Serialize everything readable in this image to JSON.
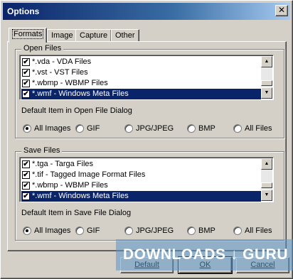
{
  "window": {
    "title": "Options",
    "close_glyph": "✕"
  },
  "tabs": [
    {
      "label": "Formats",
      "active": true
    },
    {
      "label": "Image",
      "active": false
    },
    {
      "label": "Capture",
      "active": false
    },
    {
      "label": "Other",
      "active": false
    }
  ],
  "open_files": {
    "group_label": "Open Files",
    "items": [
      {
        "label": "*.vda - VDA Files",
        "checked": true,
        "selected": false
      },
      {
        "label": "*.vst - VST Files",
        "checked": true,
        "selected": false
      },
      {
        "label": "*.wbmp - WBMP Files",
        "checked": true,
        "selected": false
      },
      {
        "label": "*.wmf - Windows Meta Files",
        "checked": true,
        "selected": true
      }
    ],
    "default_label": "Default Item in Open File Dialog",
    "radios": [
      {
        "label": "All Images",
        "selected": true
      },
      {
        "label": "GIF",
        "selected": false
      },
      {
        "label": "JPG/JPEG",
        "selected": false
      },
      {
        "label": "BMP",
        "selected": false
      },
      {
        "label": "All Files",
        "selected": false
      }
    ]
  },
  "save_files": {
    "group_label": "Save Files",
    "items": [
      {
        "label": "*.tga - Targa Files",
        "checked": true,
        "selected": false
      },
      {
        "label": "*.tif - Tagged Image Format Files",
        "checked": true,
        "selected": false
      },
      {
        "label": "*.wbmp - WBMP Files",
        "checked": true,
        "selected": false
      },
      {
        "label": "*.wmf - Windows Meta Files",
        "checked": true,
        "selected": true
      }
    ],
    "default_label": "Default Item in Save File Dialog",
    "radios": [
      {
        "label": "All Images",
        "selected": true
      },
      {
        "label": "GIF",
        "selected": false
      },
      {
        "label": "JPG/JPEG",
        "selected": false
      },
      {
        "label": "BMP",
        "selected": false
      },
      {
        "label": "All Files",
        "selected": false
      }
    ]
  },
  "buttons": {
    "default": "Default",
    "ok": "OK",
    "cancel": "Cancel"
  },
  "watermark": "DOWNLOADS ↓ GURU",
  "checkmark_glyph": "✔",
  "colors": {
    "title_bar": "#0a246a",
    "selection": "#0a246a",
    "face": "#d4d0c8"
  }
}
